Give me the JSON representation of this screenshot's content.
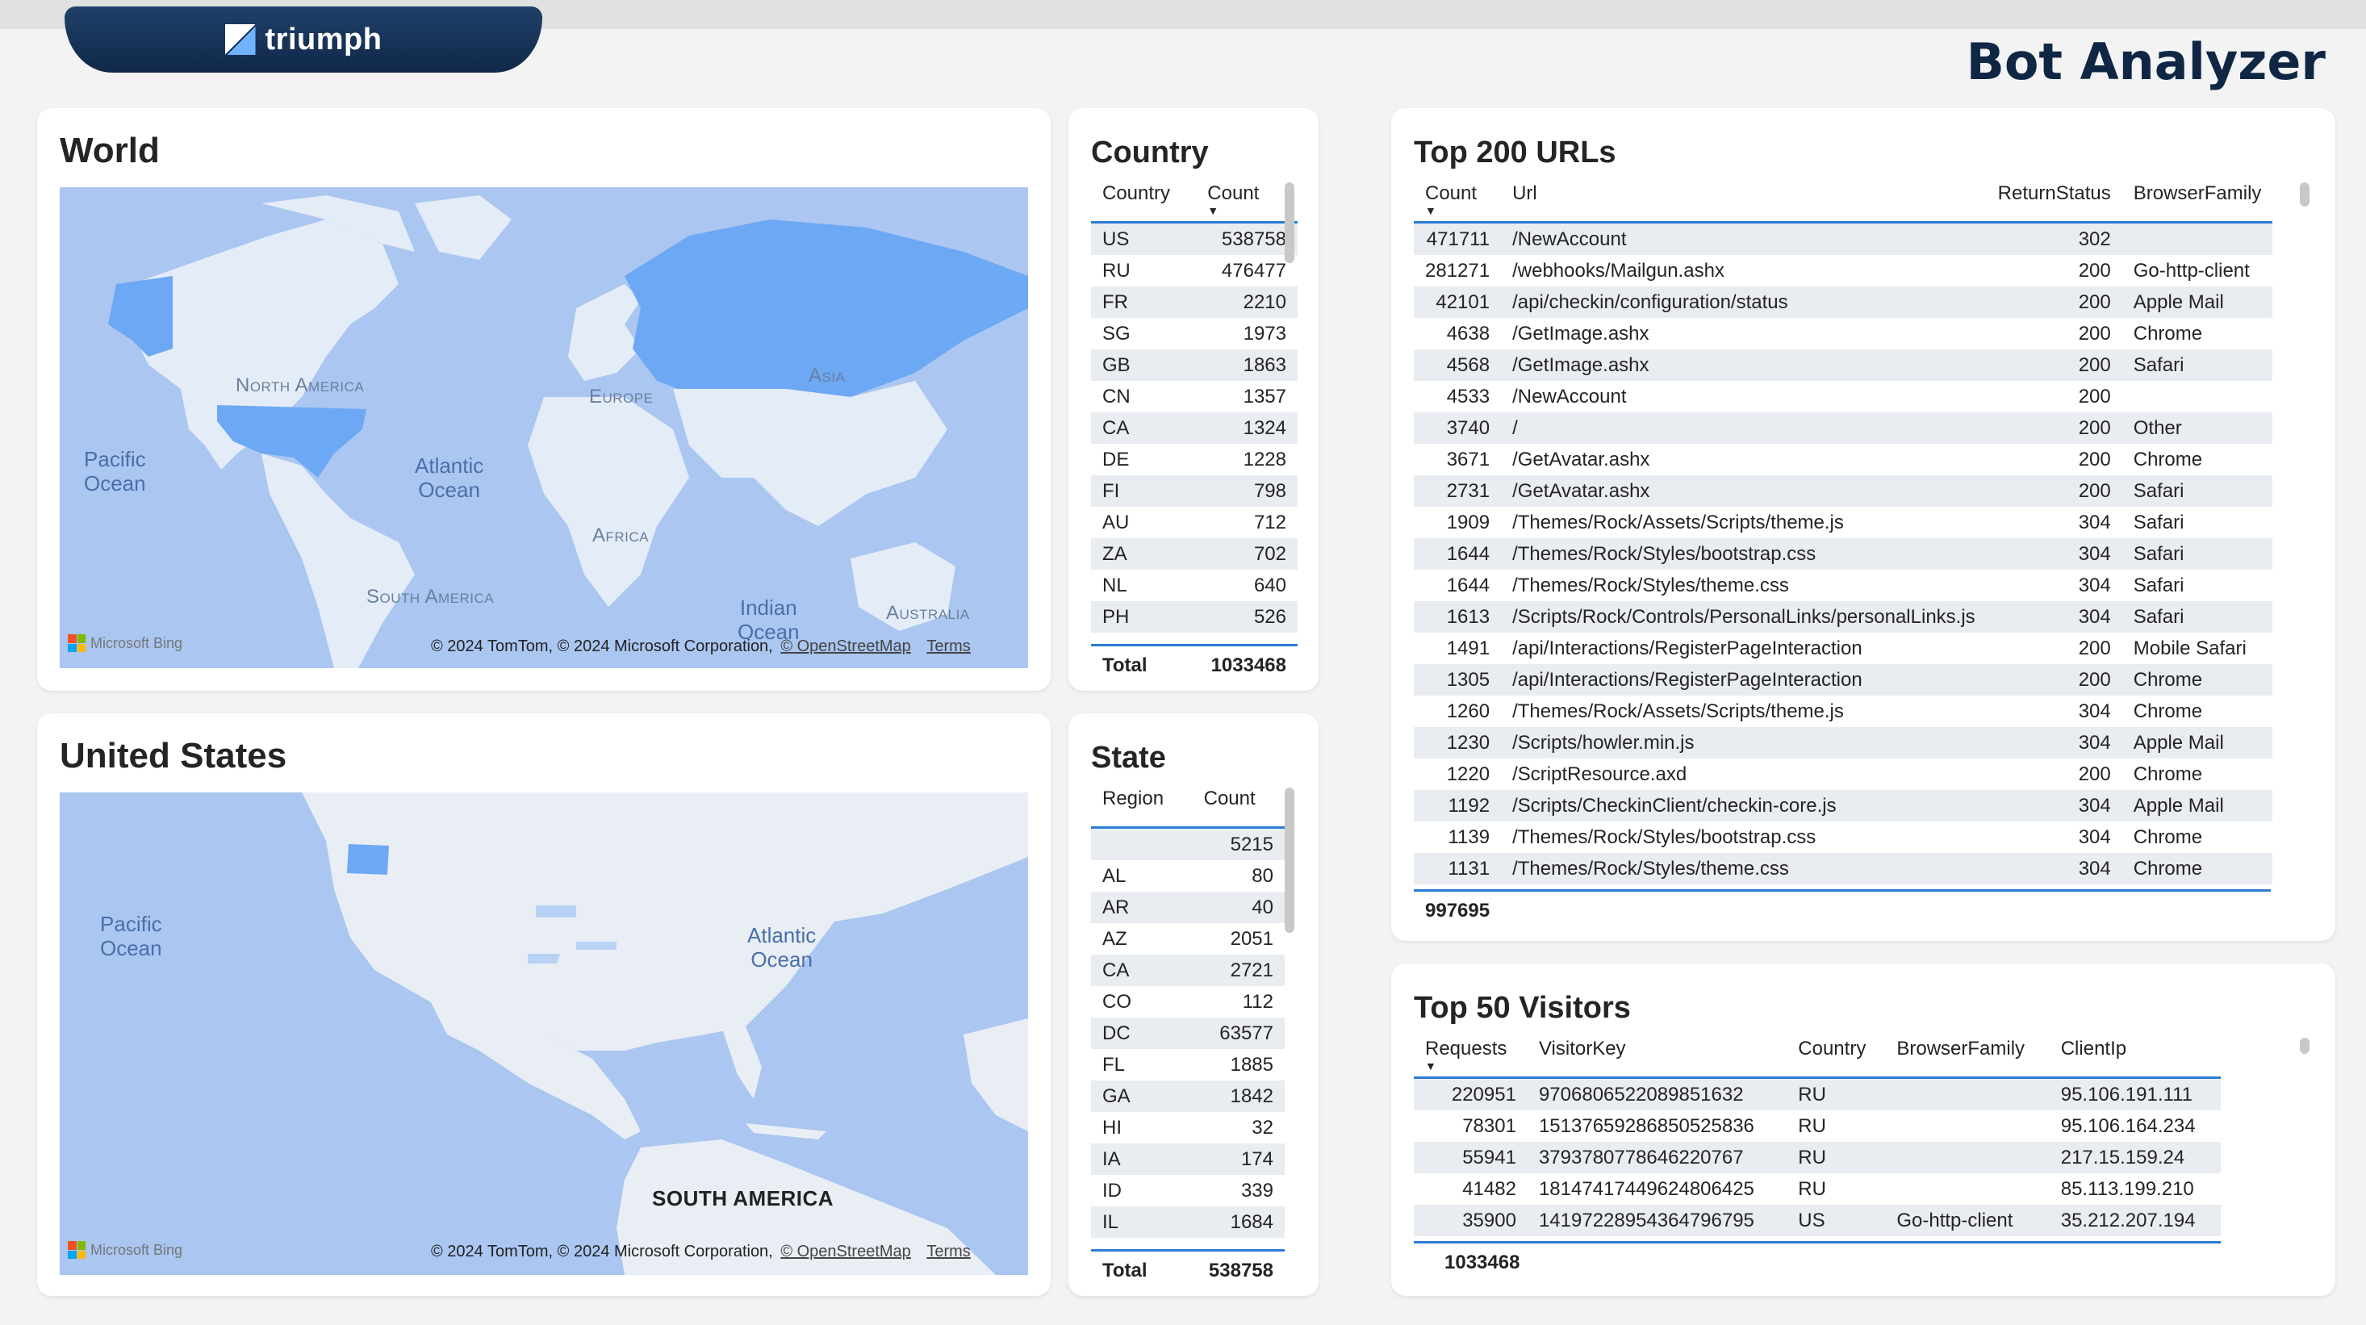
{
  "brand": {
    "logo_text": "triumph"
  },
  "app_title": "Bot Analyzer",
  "world_map": {
    "title": "World",
    "labels": {
      "pacific": "Pacific\nOcean",
      "atlantic": "Atlantic\nOcean",
      "indian": "Indian\nOcean",
      "north_america": "North America",
      "europe": "Europe",
      "asia": "Asia",
      "africa": "Africa",
      "south_america": "South America",
      "australia": "Australia"
    },
    "highlight_color": "#6da8f5",
    "attribution": "© 2024 TomTom, © 2024 Microsoft Corporation,",
    "osm_link": "© OpenStreetMap",
    "terms_link": "Terms",
    "bing": "Microsoft Bing"
  },
  "us_map": {
    "title": "United States",
    "labels": {
      "pacific": "Pacific\nOcean",
      "atlantic": "Atlantic\nOcean",
      "south_america": "SOUTH AMERICA"
    },
    "attribution": "© 2024 TomTom, © 2024 Microsoft Corporation,",
    "osm_link": "© OpenStreetMap",
    "terms_link": "Terms",
    "bing": "Microsoft Bing"
  },
  "country_table": {
    "title": "Country",
    "columns": [
      "Country",
      "Count"
    ],
    "rows": [
      [
        "US",
        "538758"
      ],
      [
        "RU",
        "476477"
      ],
      [
        "FR",
        "2210"
      ],
      [
        "SG",
        "1973"
      ],
      [
        "GB",
        "1863"
      ],
      [
        "CN",
        "1357"
      ],
      [
        "CA",
        "1324"
      ],
      [
        "DE",
        "1228"
      ],
      [
        "FI",
        "798"
      ],
      [
        "AU",
        "712"
      ],
      [
        "ZA",
        "702"
      ],
      [
        "NL",
        "640"
      ],
      [
        "PH",
        "526"
      ]
    ],
    "total_label": "Total",
    "total_value": "1033468"
  },
  "state_table": {
    "title": "State",
    "columns": [
      "Region",
      "Count"
    ],
    "rows": [
      [
        "",
        "5215"
      ],
      [
        "AL",
        "80"
      ],
      [
        "AR",
        "40"
      ],
      [
        "AZ",
        "2051"
      ],
      [
        "CA",
        "2721"
      ],
      [
        "CO",
        "112"
      ],
      [
        "DC",
        "63577"
      ],
      [
        "FL",
        "1885"
      ],
      [
        "GA",
        "1842"
      ],
      [
        "HI",
        "32"
      ],
      [
        "IA",
        "174"
      ],
      [
        "ID",
        "339"
      ],
      [
        "IL",
        "1684"
      ]
    ],
    "total_label": "Total",
    "total_value": "538758"
  },
  "urls_table": {
    "title": "Top 200 URLs",
    "columns": [
      "Count",
      "Url",
      "ReturnStatus",
      "BrowserFamily"
    ],
    "rows": [
      [
        "471711",
        "/NewAccount",
        "302",
        ""
      ],
      [
        "281271",
        "/webhooks/Mailgun.ashx",
        "200",
        "Go-http-client"
      ],
      [
        "42101",
        "/api/checkin/configuration/status",
        "200",
        "Apple Mail"
      ],
      [
        "4638",
        "/GetImage.ashx",
        "200",
        "Chrome"
      ],
      [
        "4568",
        "/GetImage.ashx",
        "200",
        "Safari"
      ],
      [
        "4533",
        "/NewAccount",
        "200",
        ""
      ],
      [
        "3740",
        "/",
        "200",
        "Other"
      ],
      [
        "3671",
        "/GetAvatar.ashx",
        "200",
        "Chrome"
      ],
      [
        "2731",
        "/GetAvatar.ashx",
        "200",
        "Safari"
      ],
      [
        "1909",
        "/Themes/Rock/Assets/Scripts/theme.js",
        "304",
        "Safari"
      ],
      [
        "1644",
        "/Themes/Rock/Styles/bootstrap.css",
        "304",
        "Safari"
      ],
      [
        "1644",
        "/Themes/Rock/Styles/theme.css",
        "304",
        "Safari"
      ],
      [
        "1613",
        "/Scripts/Rock/Controls/PersonalLinks/personalLinks.js",
        "304",
        "Safari"
      ],
      [
        "1491",
        "/api/Interactions/RegisterPageInteraction",
        "200",
        "Mobile Safari"
      ],
      [
        "1305",
        "/api/Interactions/RegisterPageInteraction",
        "200",
        "Chrome"
      ],
      [
        "1260",
        "/Themes/Rock/Assets/Scripts/theme.js",
        "304",
        "Chrome"
      ],
      [
        "1230",
        "/Scripts/howler.min.js",
        "304",
        "Apple Mail"
      ],
      [
        "1220",
        "/ScriptResource.axd",
        "200",
        "Chrome"
      ],
      [
        "1192",
        "/Scripts/CheckinClient/checkin-core.js",
        "304",
        "Apple Mail"
      ],
      [
        "1139",
        "/Themes/Rock/Styles/bootstrap.css",
        "304",
        "Chrome"
      ],
      [
        "1131",
        "/Themes/Rock/Styles/theme.css",
        "304",
        "Chrome"
      ]
    ],
    "total_value": "997695"
  },
  "visitors_table": {
    "title": "Top 50 Visitors",
    "columns": [
      "Requests",
      "VisitorKey",
      "Country",
      "BrowserFamily",
      "ClientIp"
    ],
    "rows": [
      [
        "220951",
        "9706806522089851632",
        "RU",
        "",
        "95.106.191.111"
      ],
      [
        "78301",
        "15137659286850525836",
        "RU",
        "",
        "95.106.164.234"
      ],
      [
        "55941",
        "3793780778646220767",
        "RU",
        "",
        "217.15.159.24"
      ],
      [
        "41482",
        "18147417449624806425",
        "RU",
        "",
        "85.113.199.210"
      ],
      [
        "35900",
        "14197228954364796795",
        "US",
        "Go-http-client",
        "35.212.207.194"
      ]
    ],
    "total_value": "1033468"
  }
}
